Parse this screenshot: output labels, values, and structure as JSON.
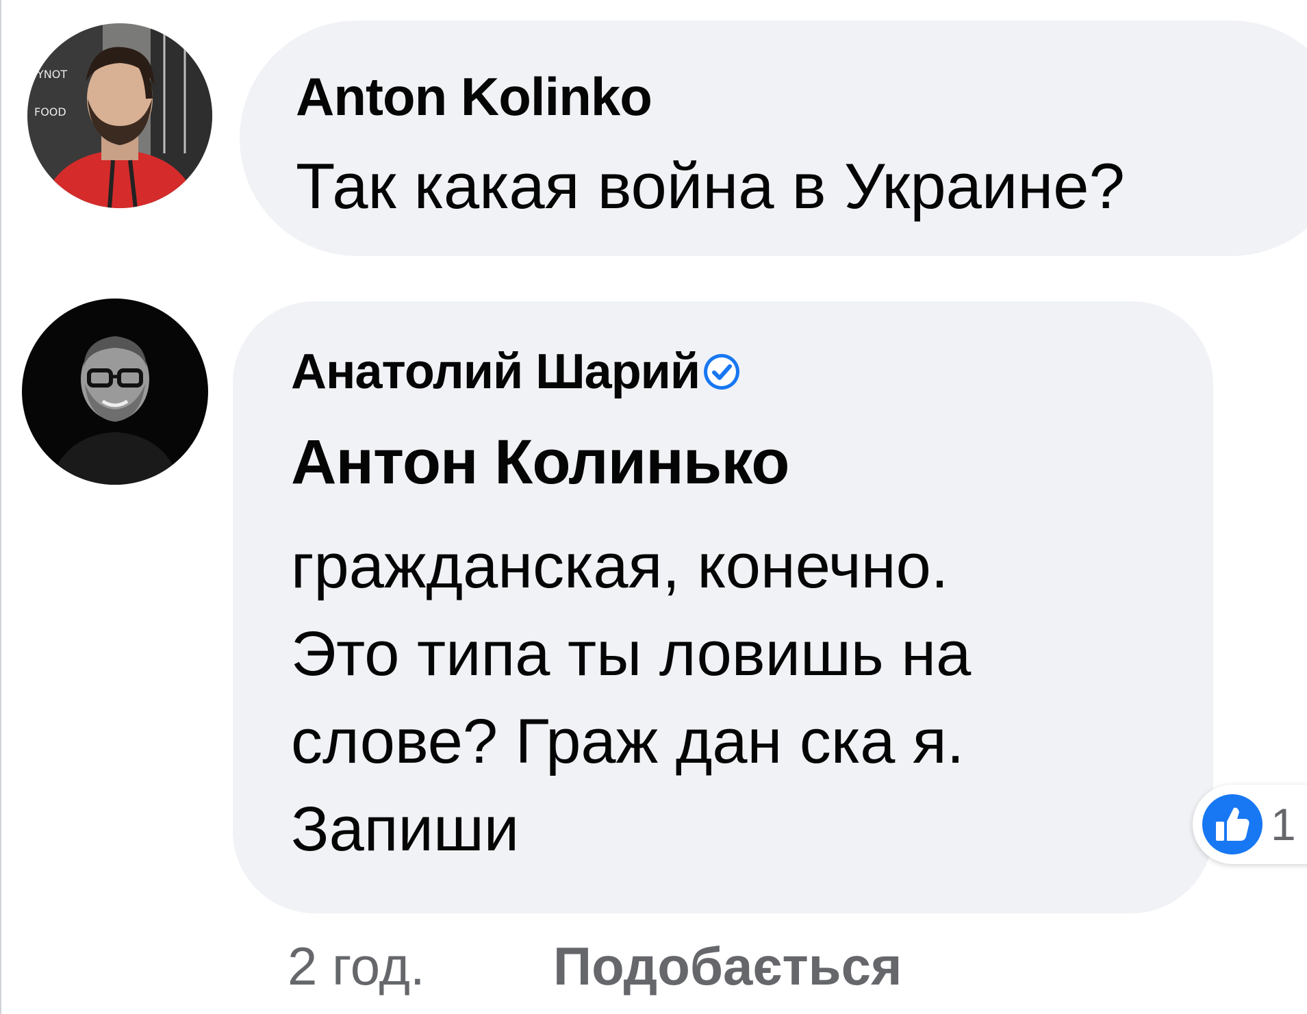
{
  "comments": [
    {
      "author": "Anton Kolinko",
      "text": "Так какая война в Украине?",
      "avatar_icon": "profile-photo"
    },
    {
      "author": "Анатолий Шарий",
      "verified": true,
      "verified_icon": "verified-badge-icon",
      "mention": "Антон Колинько",
      "lines": [
        "гражданская, конечно.",
        "Это типа ты ловишь на",
        "слове? Граж дан ска я.",
        "Запиши"
      ],
      "reaction": {
        "icon": "like-icon",
        "count": "1"
      },
      "timestamp": "2 год.",
      "like_label": "Подобається"
    }
  ],
  "colors": {
    "bubble": "#f0f2f5",
    "text": "#050505",
    "secondary": "#65676b",
    "facebook_blue": "#1877f2"
  }
}
